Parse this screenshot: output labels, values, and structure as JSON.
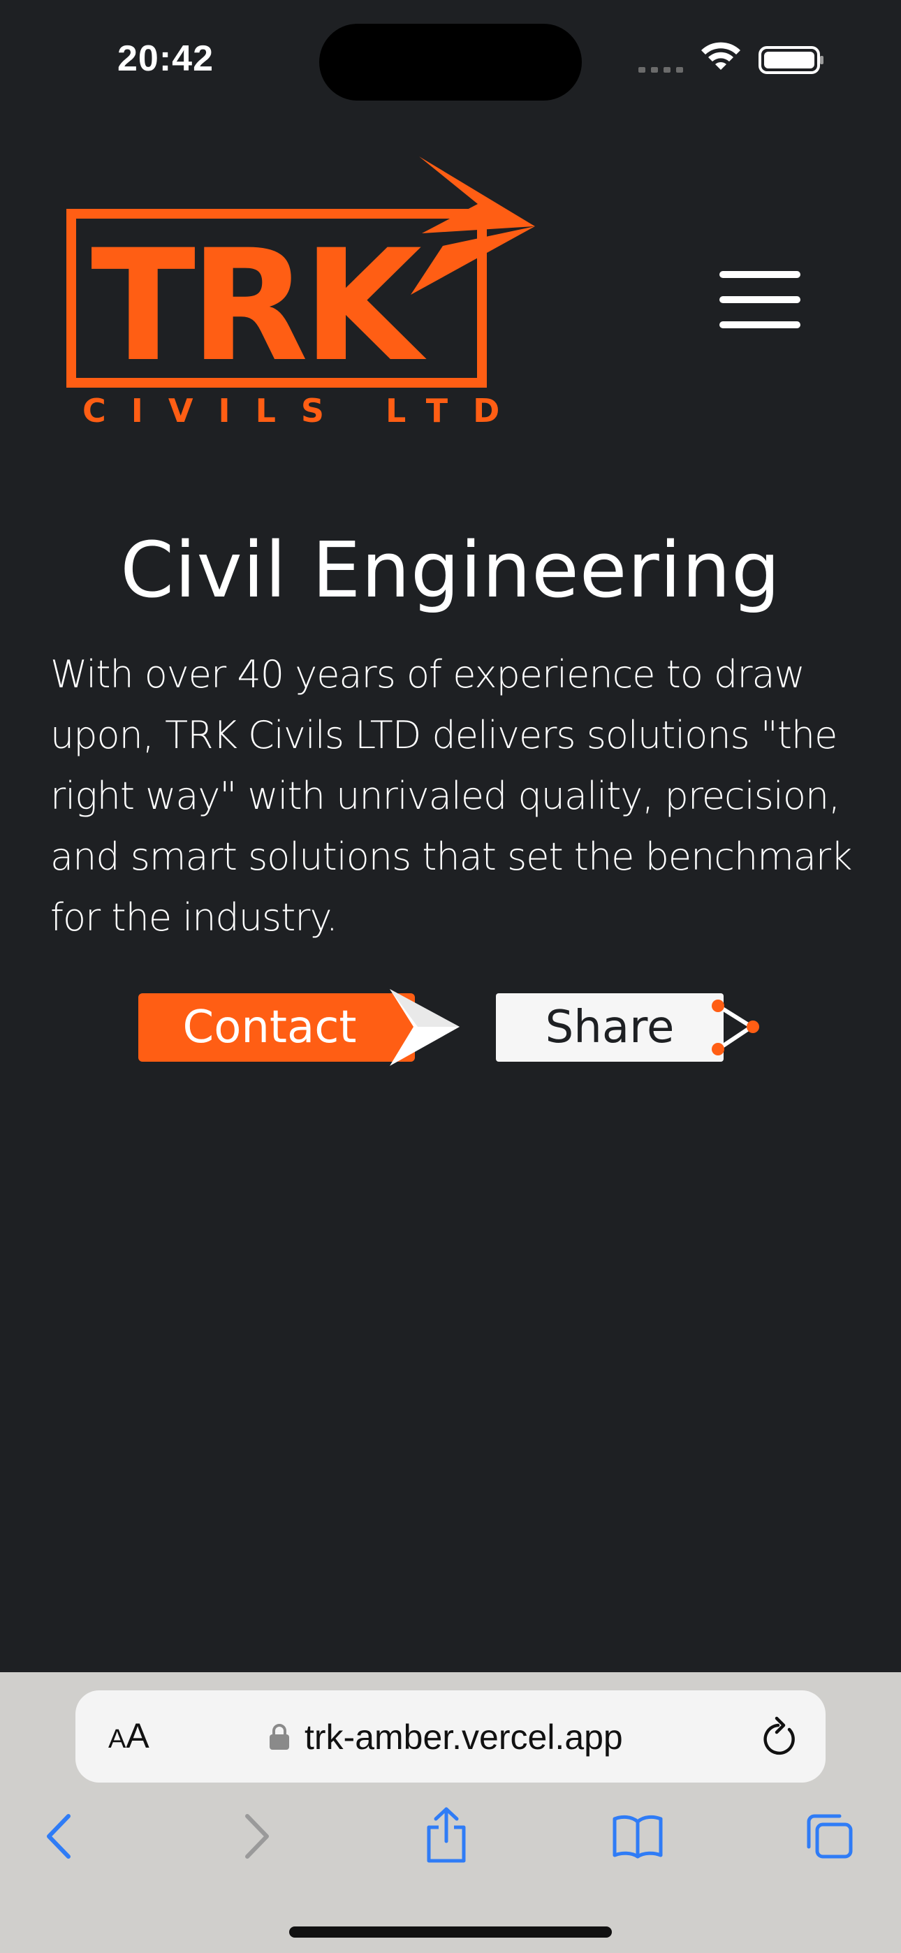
{
  "status_bar": {
    "time": "20:42",
    "icons": [
      "signal-icon",
      "wifi-icon",
      "battery-icon"
    ]
  },
  "header": {
    "logo": {
      "name": "TRK",
      "tagline": "CIVILS LTD",
      "color": "#ff5e14"
    },
    "menu_icon": "hamburger-menu-icon"
  },
  "hero": {
    "title": "Civil Engineering",
    "text": "With over 40 years of experience to draw upon, TRK Civils LTD delivers solutions \"the right way\" with unrivaled quality, precision, and smart solutions that set the benchmark for the industry.",
    "contact_label": "Contact",
    "share_label": "Share"
  },
  "browser": {
    "text_size_small": "A",
    "text_size_large": "A",
    "url": "trk-amber.vercel.app",
    "toolbar_icons": [
      "back-icon",
      "forward-icon",
      "share-icon",
      "bookmarks-icon",
      "tabs-icon"
    ]
  },
  "colors": {
    "background": "#1e2023",
    "accent": "#ff5e14",
    "safari_blue": "#2f7cf6"
  }
}
